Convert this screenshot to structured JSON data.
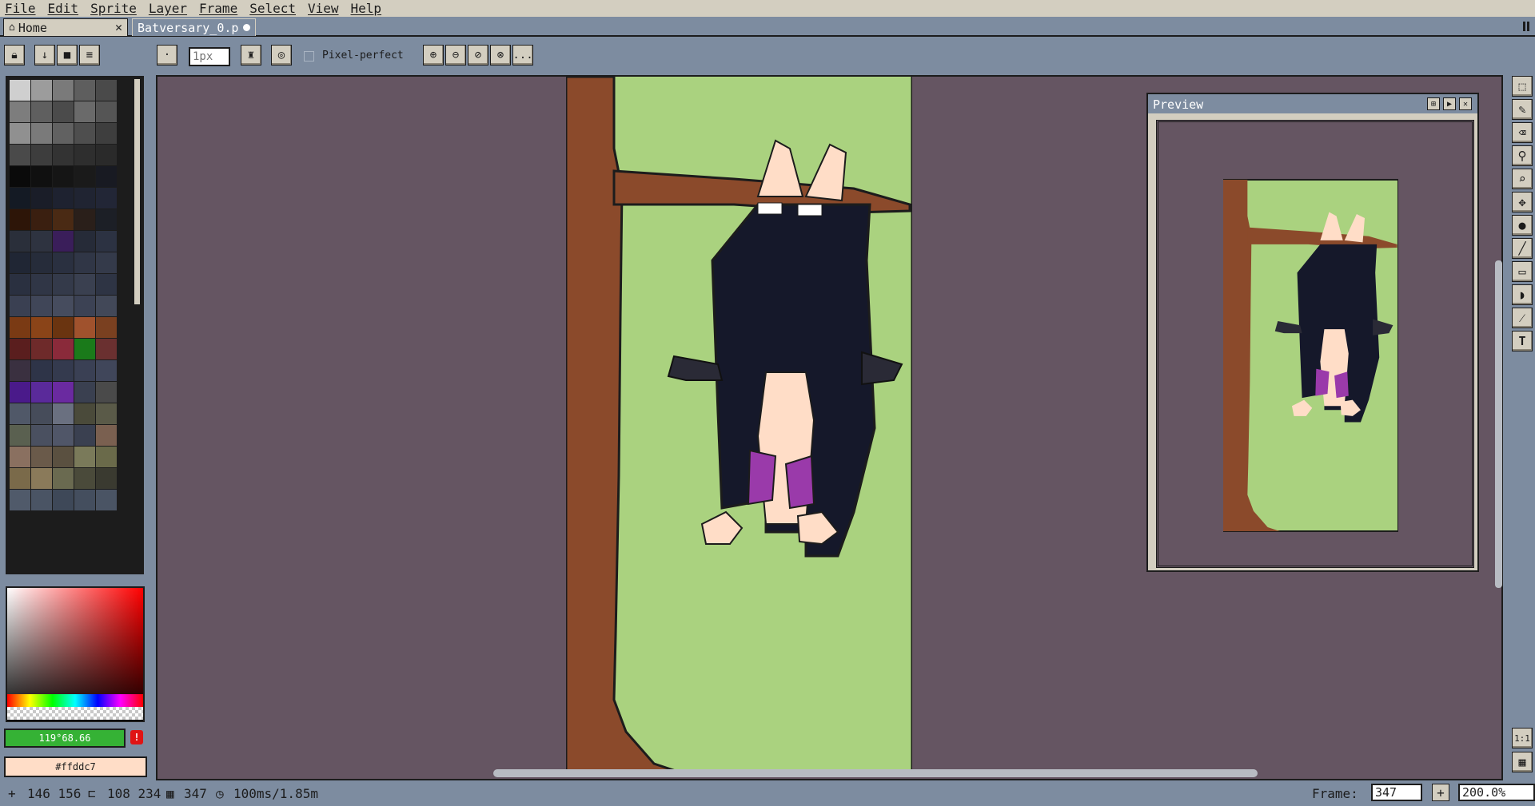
{
  "menu": [
    "File",
    "Edit",
    "Sprite",
    "Layer",
    "Frame",
    "Select",
    "View",
    "Help"
  ],
  "tabs": {
    "home": {
      "label": "Home",
      "close": "✕"
    },
    "file": {
      "label": "Batversary_0.p"
    }
  },
  "toolbar": {
    "brush_size_placeholder": "1px",
    "pixel_perfect_label": "Pixel-perfect",
    "more_label": "..."
  },
  "palette": {
    "colors": [
      "#cfcfcf",
      "#9c9c9c",
      "#7a7a7a",
      "#5e5e5e",
      "#4a4a4a",
      "#7d7d7d",
      "#5f5f5f",
      "#4b4b4b",
      "#6a6a6a",
      "#555555",
      "#909090",
      "#7a7a7a",
      "#616161",
      "#4e4e4e",
      "#3e3e3e",
      "#4a4a4a",
      "#3d3d3d",
      "#333333",
      "#2e2e2e",
      "#2a2a2a",
      "#0a0a0a",
      "#101010",
      "#151515",
      "#1a1a1a",
      "#181a22",
      "#141a24",
      "#1a1d28",
      "#1e2230",
      "#202432",
      "#222636",
      "#2d1508",
      "#3a1f10",
      "#4a2a14",
      "#2a1f1a",
      "#1c1f26",
      "#2a2f3a",
      "#2e3340",
      "#3a1e5a",
      "#262b38",
      "#2c3242",
      "#202634",
      "#262c3a",
      "#2a3040",
      "#303646",
      "#343a4a",
      "#2a3040",
      "#303646",
      "#343a4a",
      "#3a4050",
      "#2e3444",
      "#3a4052",
      "#404658",
      "#464c5e",
      "#3c4254",
      "#424858",
      "#7a3a14",
      "#8a4418",
      "#6a3410",
      "#a0522d",
      "#7a4020",
      "#5a1e1e",
      "#6e2a2a",
      "#8a2a3a",
      "#1a7a1a",
      "#6a3030",
      "#3a3040",
      "#2e3448",
      "#343a4e",
      "#3a4054",
      "#40465a",
      "#4a1a8a",
      "#5a2a9a",
      "#6a2aa0",
      "#3a4050",
      "#4a4a4a",
      "#505868",
      "#464c5a",
      "#6a7080",
      "#4a4a3a",
      "#5a5a48",
      "#5a6050",
      "#4a5060",
      "#505668",
      "#3a4050",
      "#7a6050",
      "#8a7060",
      "#6a5a4a",
      "#5a5040",
      "#7a7a5a",
      "#6a6a4a",
      "#7a6a4a",
      "#8a7a5a",
      "#6a6a50",
      "#4a4a3a",
      "#3a3a30",
      "#505a6a",
      "#4a5464",
      "#3e4858",
      "#444e5e",
      "#4a5464"
    ]
  },
  "colors": {
    "foreground_label": "119°68.66",
    "background_label": "#ffddc7",
    "warning": "!"
  },
  "preview": {
    "title": "Preview"
  },
  "status": {
    "cursor": "146 156",
    "selection": "108 234",
    "frame_count": "347",
    "duration": "100ms/1.85m",
    "frame_label": "Frame:",
    "frame_value": "347",
    "add": "+",
    "zoom": "200.0%"
  },
  "tools": [
    "marquee-tool-icon",
    "pencil-tool-icon",
    "eraser-tool-icon",
    "eyedropper-tool-icon",
    "zoom-tool-icon",
    "move-tool-icon",
    "paint-bucket-tool-icon",
    "line-tool-icon",
    "rectangle-tool-icon",
    "contour-tool-icon",
    "blur-tool-icon",
    "text-tool-icon"
  ],
  "bottom_tools": {
    "zoom_1to1": "1:1"
  }
}
